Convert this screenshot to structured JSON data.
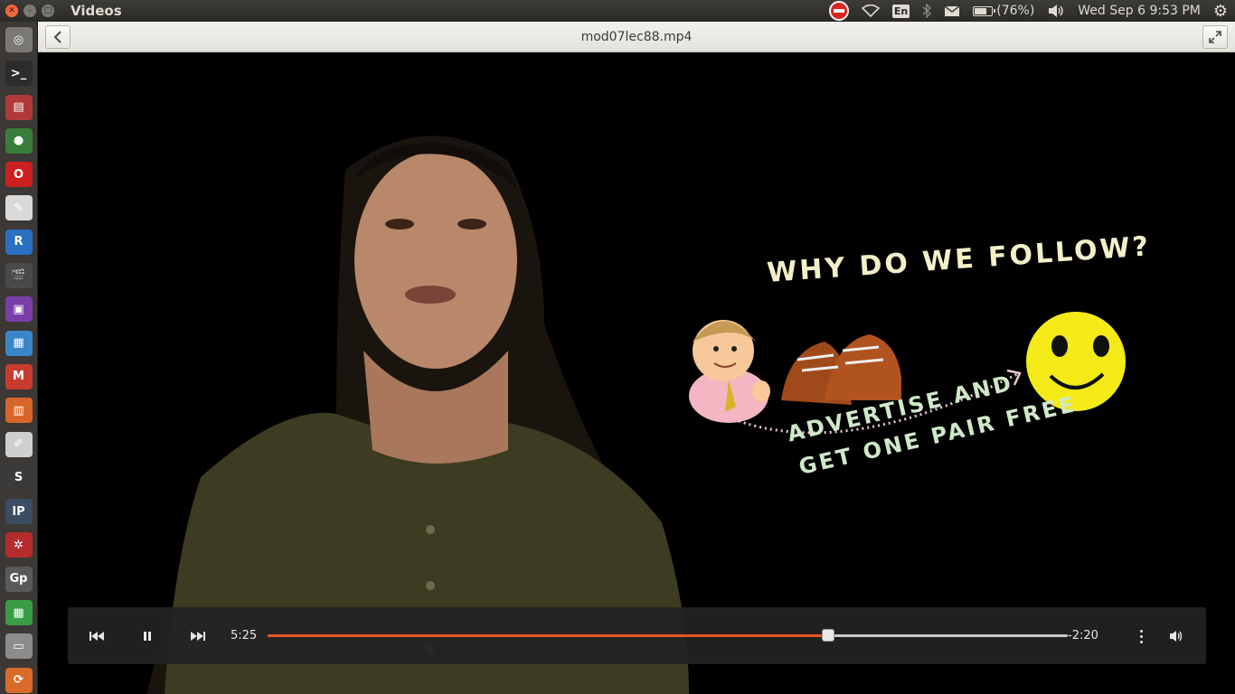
{
  "panel": {
    "app_title": "Videos",
    "keyboard_layout": "En",
    "battery_text": "(76%)",
    "battery_level": 0.76,
    "datetime": "Wed Sep  6  9:53 PM"
  },
  "launcher": {
    "items": [
      {
        "name": "dash-home-icon",
        "glyph": "◎",
        "bg": "#7a7874"
      },
      {
        "name": "terminal-icon",
        "glyph": ">_",
        "bg": "#2c2c2c"
      },
      {
        "name": "file-archive-icon",
        "glyph": "▤",
        "bg": "#b03a3a"
      },
      {
        "name": "chrome-icon",
        "glyph": "●",
        "bg": "#3a7d3a"
      },
      {
        "name": "opera-icon",
        "glyph": "O",
        "bg": "#cc1f1f"
      },
      {
        "name": "document-viewer-icon",
        "glyph": "✎",
        "bg": "#d9d9d9"
      },
      {
        "name": "r-language-icon",
        "glyph": "R",
        "bg": "#2a6fc0"
      },
      {
        "name": "videos-icon",
        "glyph": "🎬",
        "bg": "#4a4a4a"
      },
      {
        "name": "media-player-icon",
        "glyph": "▣",
        "bg": "#7a3ea8"
      },
      {
        "name": "writer-icon",
        "glyph": "▦",
        "bg": "#3a87c8"
      },
      {
        "name": "gmail-icon",
        "glyph": "M",
        "bg": "#c93a2f"
      },
      {
        "name": "impress-icon",
        "glyph": "▥",
        "bg": "#d8652a"
      },
      {
        "name": "text-editor-icon",
        "glyph": "✐",
        "bg": "#cfcfcf"
      },
      {
        "name": "sublime-text-icon",
        "glyph": "S",
        "bg": "#3a3a3a"
      },
      {
        "name": "ipython-icon",
        "glyph": "IP",
        "bg": "#3b4d63"
      },
      {
        "name": "settings-icon",
        "glyph": "✲",
        "bg": "#b52b2b"
      },
      {
        "name": "geogebra-icon",
        "glyph": "Gp",
        "bg": "#5a5a5a"
      },
      {
        "name": "calc-icon",
        "glyph": "▦",
        "bg": "#3a9c45"
      },
      {
        "name": "drive-icon",
        "glyph": "▭",
        "bg": "#8c8c8c"
      },
      {
        "name": "software-updater-icon",
        "glyph": "⟳",
        "bg": "#d96a2a"
      },
      {
        "name": "misc-app-icon",
        "glyph": "▤",
        "bg": "#8e4ea8"
      }
    ]
  },
  "header": {
    "file_title": "mod07lec88.mp4"
  },
  "video_overlay": {
    "heading": "WHY DO WE FOLLOW?",
    "line1": "ADVERTISE AND",
    "line2": "GET ONE PAIR FREE"
  },
  "player": {
    "elapsed": "5:25",
    "remaining": "-2:20",
    "progress": 0.7,
    "accent": "#e95420"
  }
}
